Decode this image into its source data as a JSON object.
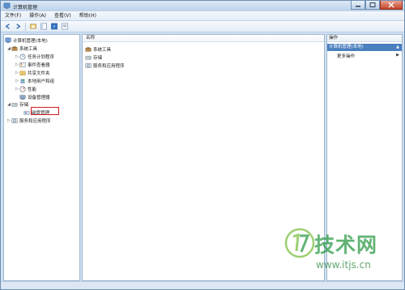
{
  "window": {
    "title": "计算机管理"
  },
  "menu": [
    "文件(F)",
    "操作(A)",
    "查看(V)",
    "帮助(H)"
  ],
  "tree": {
    "root": "计算机管理(本地)",
    "system_tools": "系统工具",
    "task_scheduler": "任务计划程序",
    "event_viewer": "事件查看器",
    "shared_folders": "共享文件夹",
    "local_users": "本地用户和组",
    "performance": "性能",
    "device_manager": "设备管理器",
    "storage": "存储",
    "disk_management": "磁盘管理",
    "services_apps": "服务和应用程序"
  },
  "list": {
    "header": "名称",
    "items": [
      "系统工具",
      "存储",
      "服务和应用程序"
    ]
  },
  "actions": {
    "header": "操作",
    "section": "计算机管理(本地)",
    "more": "更多操作"
  },
  "watermark": {
    "brand": "技术网",
    "url": "www.itjs.cn"
  },
  "colors": {
    "highlight": "#d11a1a",
    "section_bg": "#4a7fc0",
    "watermark": "#2e9a46"
  }
}
